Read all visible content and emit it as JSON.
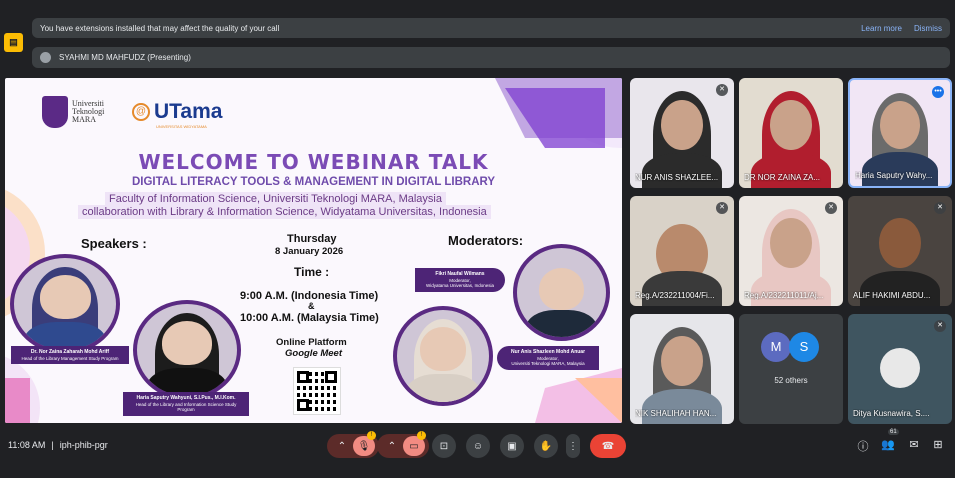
{
  "notice": {
    "text": "You have extensions installed that may affect the quality of your call",
    "learn_more": "Learn more",
    "dismiss": "Dismiss"
  },
  "presenting": {
    "text": "SYAHMI MD MAHFUDZ (Presenting)"
  },
  "slide": {
    "uitm_lines": [
      "Universiti",
      "Teknologi",
      "MARA"
    ],
    "utama": "UTama",
    "utama_sub": "UNIVERSITAS WIDYATAMA",
    "title": "WELCOME TO WEBINAR TALK",
    "subtitle": "DIGITAL LITERACY TOOLS & MANAGEMENT IN DIGITAL LIBRARY",
    "line1": "Faculty of Information Science, Universiti Teknologi MARA, Malaysia",
    "line2": "collaboration with Library & Information Science, Widyatama Universitas, Indonesia",
    "speakers_label": "Speakers :",
    "moderators_label": "Moderators:",
    "day": "Thursday",
    "date": "8 January 2026",
    "time_label": "Time :",
    "time1": "9:00 A.M. (Indonesia Time)",
    "amp": "&",
    "time2": "10:00 A.M. (Malaysia Time)",
    "platform_label": "Online Platform",
    "platform": "Google Meet",
    "speaker1_name": "Dr. Nor Zaina Zaharah Mohd Ariff",
    "speaker1_role": "Head of the Library Management Study Program",
    "speaker2_name": "Haria Saputry Wahyuni, S.I.Pus., M.I.Kom.",
    "speaker2_role": "Head of the Library and Information Science Study Program",
    "mod1_name": "Fikri Naufal Wilmans",
    "mod1_role": "Moderator,",
    "mod1_org": "Widyatama Universitas, Indonesia",
    "mod2_name": "Nur Anis Shazleen Mohd Anuar",
    "mod2_role": "Moderator,",
    "mod2_org": "Universiti Teknologi MARA, Malaysia"
  },
  "tiles": [
    {
      "name": "NUR ANIS SHAZLEE..."
    },
    {
      "name": "DR NOR ZAINA ZA..."
    },
    {
      "name": "Haria Saputry Wahy..."
    },
    {
      "name": "Reg.A/232211004/Fi..."
    },
    {
      "name": "Reg.A/232211011/Aj..."
    },
    {
      "name": "ALIF HAKIMI ABDU..."
    },
    {
      "name": "NIK SHALIHAH HAN..."
    },
    {
      "name": "52 others",
      "initials": [
        "M",
        "S"
      ]
    },
    {
      "name": "Ditya Kusnawira, S...."
    }
  ],
  "bottom": {
    "time": "11:08 AM",
    "separator": "|",
    "meeting_code": "iph-phib-pgr",
    "participants_count": "61",
    "badge": "!"
  },
  "colors": {
    "accent": "#ea4335",
    "bg": "#202124",
    "tile": "#3c4043",
    "slide_purple": "#7b4bb5"
  }
}
